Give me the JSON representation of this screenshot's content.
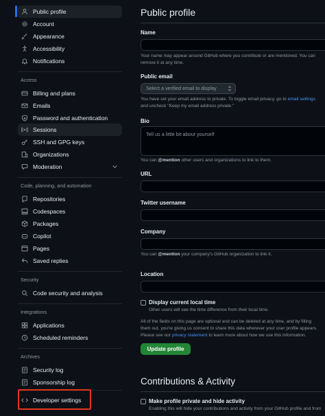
{
  "sidebar": {
    "top_items": [
      {
        "label": "Public profile",
        "icon": "person-icon"
      },
      {
        "label": "Account",
        "icon": "gear-icon"
      },
      {
        "label": "Appearance",
        "icon": "paintbrush-icon"
      },
      {
        "label": "Accessibility",
        "icon": "accessibility-icon"
      },
      {
        "label": "Notifications",
        "icon": "bell-icon"
      }
    ],
    "access": {
      "heading": "Access",
      "items": [
        {
          "label": "Billing and plans",
          "icon": "credit-card-icon"
        },
        {
          "label": "Emails",
          "icon": "mail-icon"
        },
        {
          "label": "Password and authentication",
          "icon": "shield-lock-icon"
        },
        {
          "label": "Sessions",
          "icon": "broadcast-icon"
        },
        {
          "label": "SSH and GPG keys",
          "icon": "key-icon"
        },
        {
          "label": "Organizations",
          "icon": "organization-icon"
        },
        {
          "label": "Moderation",
          "icon": "report-icon"
        }
      ]
    },
    "code": {
      "heading": "Code, planning, and automation",
      "items": [
        {
          "label": "Repositories",
          "icon": "repo-icon"
        },
        {
          "label": "Codespaces",
          "icon": "codespaces-icon"
        },
        {
          "label": "Packages",
          "icon": "package-icon"
        },
        {
          "label": "Copilot",
          "icon": "copilot-icon"
        },
        {
          "label": "Pages",
          "icon": "browser-icon"
        },
        {
          "label": "Saved replies",
          "icon": "reply-icon"
        }
      ]
    },
    "security": {
      "heading": "Security",
      "items": [
        {
          "label": "Code security and analysis",
          "icon": "codescan-icon"
        }
      ]
    },
    "integrations": {
      "heading": "Integrations",
      "items": [
        {
          "label": "Applications",
          "icon": "apps-icon"
        },
        {
          "label": "Scheduled reminders",
          "icon": "clock-icon"
        }
      ]
    },
    "archives": {
      "heading": "Archives",
      "items": [
        {
          "label": "Security log",
          "icon": "log-icon"
        },
        {
          "label": "Sponsorship log",
          "icon": "log-icon"
        }
      ]
    },
    "developer": {
      "label": "Developer settings",
      "icon": "code-icon"
    }
  },
  "main": {
    "title": "Public profile",
    "name": {
      "label": "Name",
      "help": [
        "Your name may appear around GitHub where you contribute or are mentioned. You can",
        "remove it at any time."
      ]
    },
    "public_email": {
      "label": "Public email",
      "select_value": "Select a verified email to display",
      "help_line1_pre": "You have set your email address to private. To toggle email privacy, go to ",
      "help_line1_link": "email settings",
      "help_line2": "and uncheck \"Keep my email address private.\""
    },
    "bio": {
      "label": "Bio",
      "placeholder": "Tell us a little bit about yourself",
      "help_pre": "You can ",
      "help_bold": "@mention",
      "help_post": " other users and organizations to link to them."
    },
    "url": {
      "label": "URL"
    },
    "twitter": {
      "label": "Twitter username"
    },
    "company": {
      "label": "Company",
      "help_pre": "You can ",
      "help_bold": "@mention",
      "help_post": " your company's GitHub organization to link it."
    },
    "location": {
      "label": "Location"
    },
    "local_time": {
      "label": "Display current local time",
      "help": "Other users will see the time difference from their local time."
    },
    "notice": {
      "line1": "All of the fields on this page are optional and can be deleted at any time, and by filling",
      "line2": "them out, you're giving us consent to share this data wherever your user profile appears.",
      "line3_pre": "Please see our ",
      "line3_link": "privacy statement",
      "line3_post": " to learn more about how we use this information."
    },
    "update_button": "Update profile",
    "contributions": {
      "title": "Contributions & Activity",
      "private_label": "Make profile private and hide activity",
      "private_help": "Enabling this will hide your contributions and activity from your GitHub profile and from"
    }
  },
  "colors": {
    "background": "#0d1117",
    "active_item": "#1c2128",
    "accent_blue": "#1f6feb",
    "link": "#4493f8",
    "button_green": "#238636",
    "highlight_red": "#e5351f"
  }
}
